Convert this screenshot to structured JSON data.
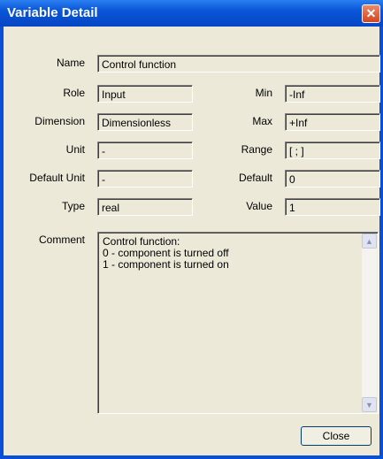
{
  "window": {
    "title": "Variable Detail"
  },
  "labels": {
    "name": "Name",
    "role": "Role",
    "dimension": "Dimension",
    "unit": "Unit",
    "default_unit": "Default Unit",
    "type": "Type",
    "comment": "Comment",
    "min": "Min",
    "max": "Max",
    "range": "Range",
    "default": "Default",
    "value": "Value"
  },
  "values": {
    "name": "Control function",
    "role": "Input",
    "dimension": "Dimensionless",
    "unit": "-",
    "default_unit": "-",
    "type": "real",
    "min": "-Inf",
    "max": "+Inf",
    "range": "[ ; ]",
    "default": "0",
    "value": "1"
  },
  "comment": {
    "line1": "Control function:",
    "line2": "0 - component is turned off",
    "line3": "1 - component is turned on"
  },
  "buttons": {
    "close": "Close"
  },
  "icons": {
    "close_title": "close-icon",
    "scroll_up": "arrow-up-icon",
    "scroll_down": "arrow-down-icon"
  },
  "colors": {
    "titlebar": "#0a55d8",
    "window_bg": "#ece9d8",
    "close_btn": "#d5451f"
  }
}
